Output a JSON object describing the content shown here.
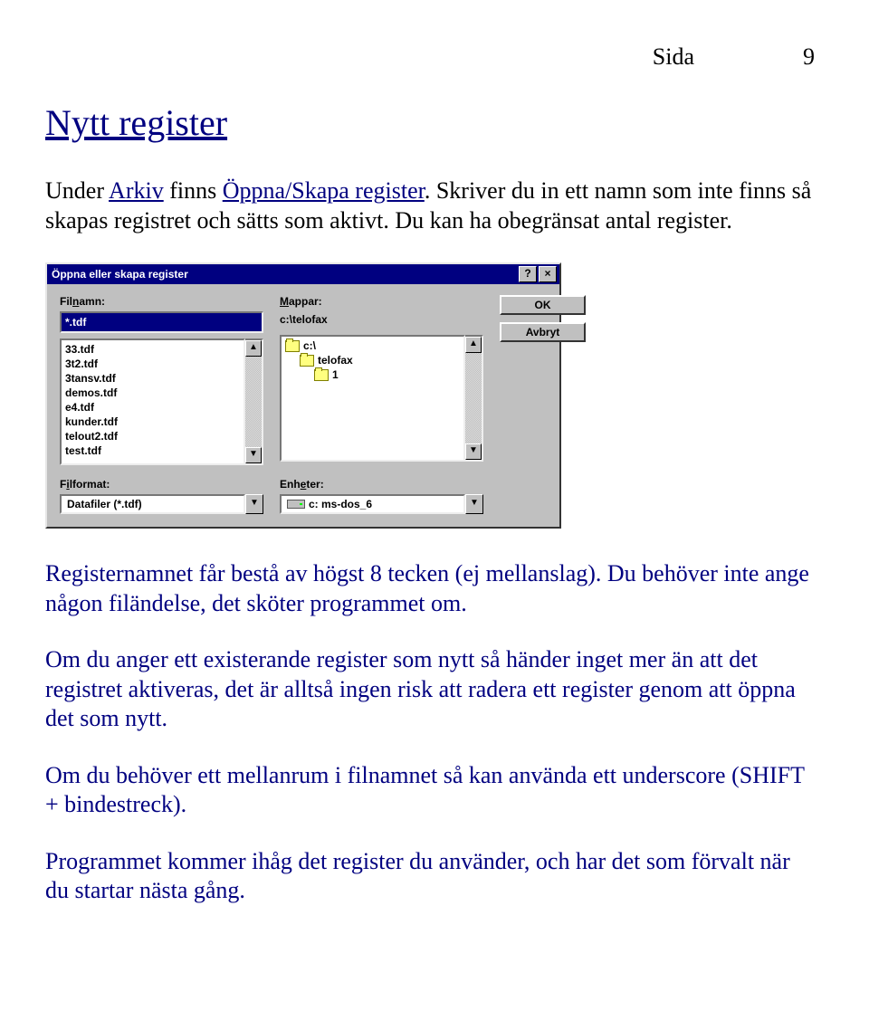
{
  "page": {
    "label": "Sida",
    "number": "9"
  },
  "section_title": "Nytt register",
  "intro": {
    "pre": "Under ",
    "arkiv": "Arkiv",
    "mid1": " finns ",
    "oppna": "Öppna/Skapa register",
    "post": ". Skriver du in ett namn som inte finns så skapas registret och sätts som aktivt. Du kan ha obegränsat antal register."
  },
  "para2": "Registernamnet får bestå av högst 8 tecken (ej mellanslag). Du behöver inte ange någon filändelse, det sköter programmet om.",
  "para3": "Om du anger ett existerande register som nytt så händer inget mer än att det registret aktiveras, det är alltså ingen risk att radera ett register genom att öppna det som nytt.",
  "para4": "Om du behöver ett mellanrum i filnamnet så kan använda ett underscore (SHIFT + bindestreck).",
  "para5": "Programmet kommer ihåg det register du använder, och har det som förvalt när du startar nästa gång.",
  "dlg": {
    "title": "Öppna eller skapa register",
    "btn_help": "?",
    "btn_close": "×",
    "filnamn": {
      "prefix": "Fil",
      "under": "n",
      "suffix": "amn:"
    },
    "filnamn_value": "*.tdf",
    "mappar": {
      "under": "M",
      "suffix": "appar:"
    },
    "path": "c:\\telofax",
    "filelist": [
      "33.tdf",
      "3t2.tdf",
      "3tansv.tdf",
      "demos.tdf",
      "e4.tdf",
      "kunder.tdf",
      "telout2.tdf",
      "test.tdf"
    ],
    "tree": [
      {
        "icon": "folder-open",
        "label": "c:\\",
        "indent": 0
      },
      {
        "icon": "folder-open",
        "label": "telofax",
        "indent": 1
      },
      {
        "icon": "folder",
        "label": "1",
        "indent": 2
      }
    ],
    "ok": "OK",
    "avbryt": "Avbryt",
    "filformat": {
      "prefix": "F",
      "under": "i",
      "suffix": "lformat:"
    },
    "filformat_value": "Datafiler (*.tdf)",
    "enheter": {
      "prefix": "Enh",
      "under": "e",
      "suffix": "ter:"
    },
    "enheter_value": "c: ms-dos_6",
    "arrow_up": "▲",
    "arrow_down": "▼"
  }
}
